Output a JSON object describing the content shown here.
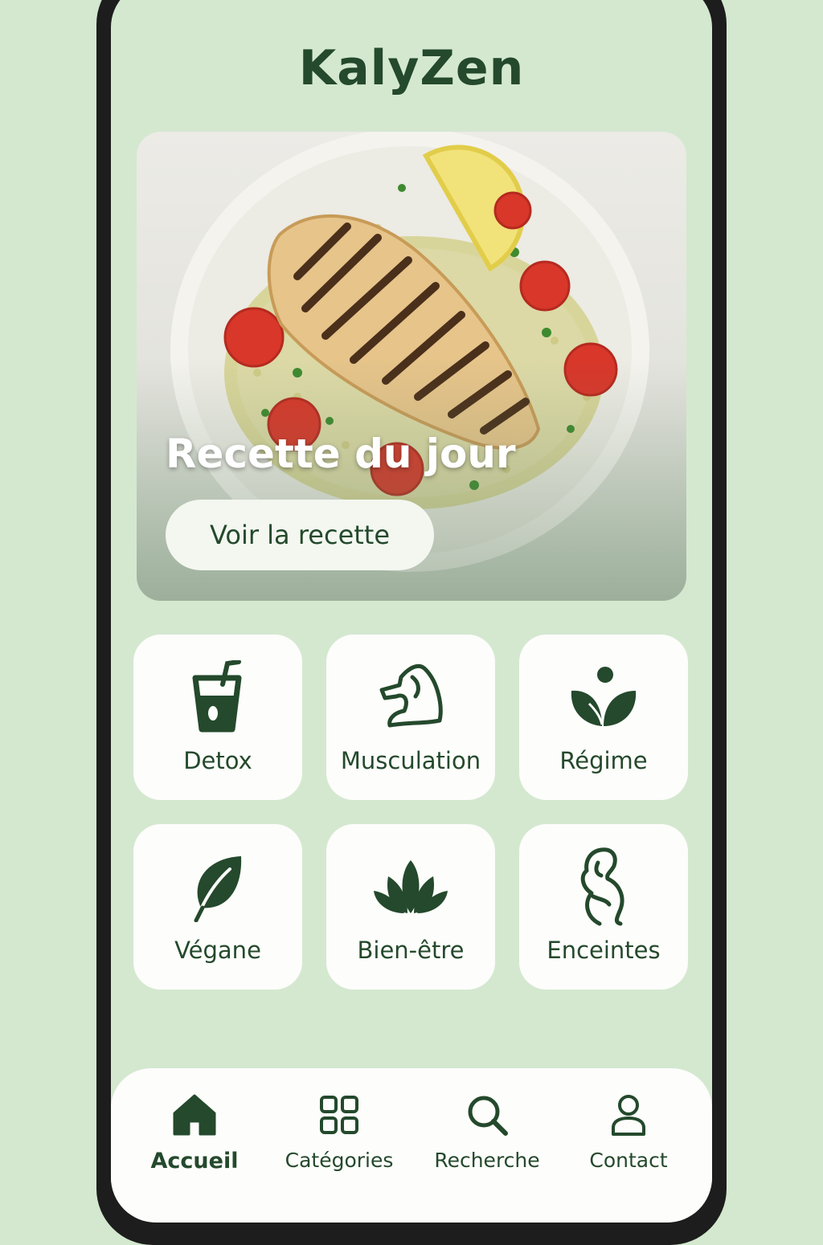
{
  "app": {
    "title": "KalyZen"
  },
  "hero": {
    "title": "Recette du jour",
    "button_label": "Voir la recette"
  },
  "categories": [
    {
      "label": "Detox",
      "icon": "drink-glass-icon"
    },
    {
      "label": "Musculation",
      "icon": "flexed-arm-icon"
    },
    {
      "label": "Régime",
      "icon": "sprout-icon"
    },
    {
      "label": "Végane",
      "icon": "leaf-icon"
    },
    {
      "label": "Bien-être",
      "icon": "lotus-icon"
    },
    {
      "label": "Enceintes",
      "icon": "pregnant-woman-icon"
    }
  ],
  "nav": [
    {
      "label": "Accueil",
      "icon": "home-icon",
      "active": true
    },
    {
      "label": "Catégories",
      "icon": "grid-icon",
      "active": false
    },
    {
      "label": "Recherche",
      "icon": "search-icon",
      "active": false
    },
    {
      "label": "Contact",
      "icon": "user-icon",
      "active": false
    }
  ],
  "colors": {
    "accent": "#24492c",
    "background": "#d4e8d0",
    "card": "#fdfdfb"
  }
}
